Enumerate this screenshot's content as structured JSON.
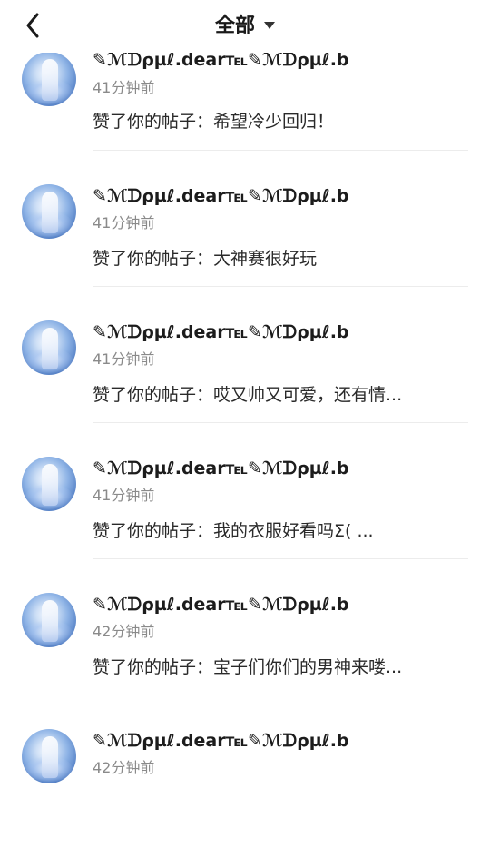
{
  "header": {
    "title": "全部"
  },
  "notifications": [
    {
      "name": "✎ℳᗪρµℓ.dear℡✎ℳᗪρµℓ.b",
      "time": "41分钟前",
      "message": "赞了你的帖子：希望冷少回归！"
    },
    {
      "name": "✎ℳᗪρµℓ.dear℡✎ℳᗪρµℓ.b",
      "time": "41分钟前",
      "message": "赞了你的帖子：大神赛很好玩"
    },
    {
      "name": "✎ℳᗪρµℓ.dear℡✎ℳᗪρµℓ.b",
      "time": "41分钟前",
      "message": "赞了你的帖子：哎又帅又可爱，还有情..."
    },
    {
      "name": "✎ℳᗪρµℓ.dear℡✎ℳᗪρµℓ.b",
      "time": "41分钟前",
      "message": "赞了你的帖子：我的衣服好看吗Σ( ..."
    },
    {
      "name": "✎ℳᗪρµℓ.dear℡✎ℳᗪρµℓ.b",
      "time": "42分钟前",
      "message": "赞了你的帖子：宝子们你们的男神来喽..."
    },
    {
      "name": "✎ℳᗪρµℓ.dear℡✎ℳᗪρµℓ.b",
      "time": "42分钟前",
      "message": ""
    }
  ]
}
